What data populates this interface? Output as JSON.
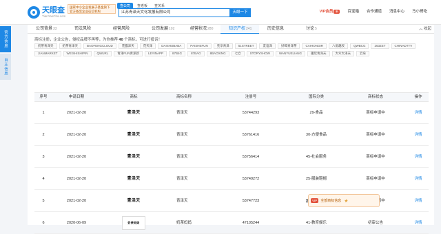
{
  "header": {
    "logo_title": "天眼查",
    "logo_url": "TianYanCha.com",
    "notice": "国家中小企业发展子基金旗下 官方备案企业征信机构",
    "search_tabs": [
      "查公司",
      "查老板",
      "查关系"
    ],
    "search_value": "江苏青泽天文化发展有限公司",
    "search_button": "天眼一下",
    "nav": {
      "vip": "VIP会员",
      "vip_badge": "新",
      "baibao": "百宝箱",
      "cooperate": "合作通道",
      "message": "消息中心",
      "user": "马小哥吃"
    }
  },
  "side": [
    "官方信息",
    "自主信息"
  ],
  "tabs": [
    {
      "label": "公司背景",
      "count": "33"
    },
    {
      "label": "司法风险",
      "count": ""
    },
    {
      "label": "经营风险",
      "count": ""
    },
    {
      "label": "公司发展",
      "count": "102"
    },
    {
      "label": "经营状况",
      "count": "280"
    },
    {
      "label": "知识产权",
      "count": "241"
    },
    {
      "label": "历史信息",
      "count": ""
    },
    {
      "label": "讨论",
      "count": "5"
    }
  ],
  "collapse": "收起",
  "desc": {
    "pre": "商标注册，企业公告，侵权品牌不再等，为你推荐 ",
    "count": "40",
    "post": " 个商标，可进行投诉！"
  },
  "chips": [
    "奶茶青泽天",
    "奶茶青泽天",
    "BAOFENGCLOUD",
    "花露泽天",
    "花天泽",
    "DAISHUBABA",
    "PAISHEFUN",
    "先享青泽",
    "51STREET",
    "友谊泽",
    "好喝青泽茶",
    "CAIHONGIR",
    "八角趣权",
    "QWBCG",
    "263ZET",
    "CHINADTTV",
    "JIANMARKET",
    "WEISHISHIPIN",
    "QWURL",
    "青泽FUN青泽新",
    "LEYINAPP",
    "87B4G",
    "87BAG",
    "8BAOXING",
    "七仓",
    "STORYSHOW",
    "WANYUELIANG",
    "趣玩青泽天",
    "大众大泽天",
    "云朵"
  ],
  "table": {
    "headers": [
      "序号",
      "申请日期",
      "商标",
      "商标名称",
      "注册号",
      "国际分类",
      "商标状态",
      "操作"
    ],
    "rows": [
      {
        "no": "1",
        "date": "2021-02-20",
        "logo": "青泽天",
        "name": "青泽天",
        "reg": "53744293",
        "cls": "29-食品",
        "status": "商标申请中",
        "op": "详情"
      },
      {
        "no": "2",
        "date": "2021-02-20",
        "logo": "青泽天",
        "name": "青泽天",
        "reg": "53761416",
        "cls": "30-方便食品",
        "status": "商标申请中",
        "op": "详情"
      },
      {
        "no": "3",
        "date": "2021-02-20",
        "logo": "青泽天",
        "name": "青泽天",
        "reg": "53756414",
        "cls": "45-社会服务",
        "status": "商标申请中",
        "op": "详情"
      },
      {
        "no": "4",
        "date": "2021-02-20",
        "logo": "青泽天",
        "name": "青泽天",
        "reg": "53749272",
        "cls": "25-服装鞋帽",
        "status": "商标申请中",
        "op": "详情"
      },
      {
        "no": "5",
        "date": "2021-02-20",
        "logo": "青泽天",
        "name": "青泽天",
        "reg": "53747723",
        "cls": "32-啤酒饮料",
        "status": "商标申请中",
        "op": "详情"
      },
      {
        "no": "6",
        "date": "2020-06-09",
        "logo": "奶茶妈妈",
        "name": "奶茶妈妈",
        "reg": "47105244",
        "cls": "41-教育娱乐",
        "status": "初审公告",
        "op": "详情"
      }
    ]
  },
  "float_ad": {
    "badge": "VIP",
    "text": "全部商标信息",
    "star": "★"
  },
  "colors": {
    "accent": "#1e88e5",
    "vip": "#e2513b"
  }
}
